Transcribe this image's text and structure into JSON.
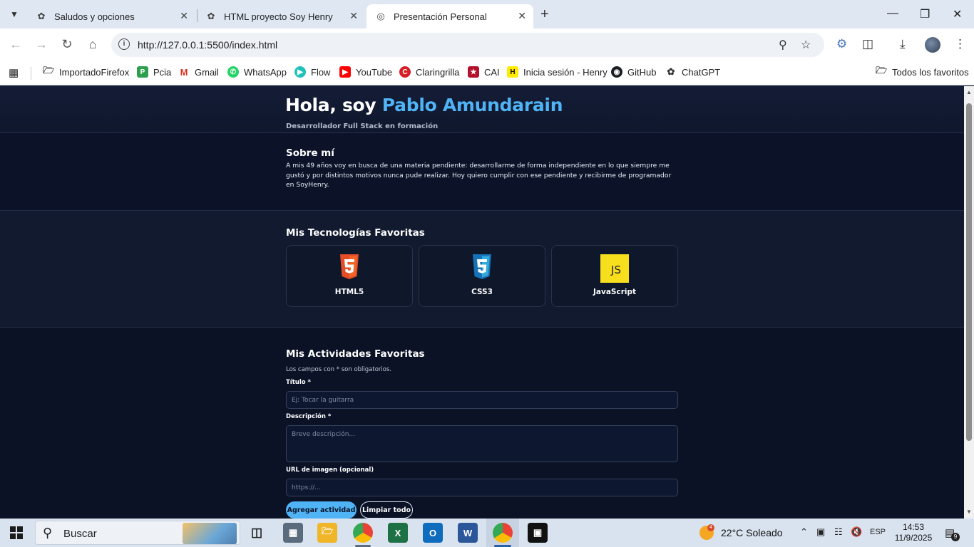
{
  "browser": {
    "tabs": [
      {
        "title": "Saludos y opciones",
        "icon": "chatgpt-icon",
        "active": false
      },
      {
        "title": "HTML proyecto Soy Henry",
        "icon": "chatgpt-icon",
        "active": false
      },
      {
        "title": "Presentación Personal",
        "icon": "globe-icon",
        "active": true
      }
    ],
    "url": "http://127.0.0.1:5500/index.html",
    "bookmarks": [
      {
        "label": "ImportadoFirefox",
        "icon": "folder-icon"
      },
      {
        "label": "Pcia",
        "icon": "pcia-icon"
      },
      {
        "label": "Gmail",
        "icon": "gmail-icon"
      },
      {
        "label": "WhatsApp",
        "icon": "whatsapp-icon"
      },
      {
        "label": "Flow",
        "icon": "flow-icon"
      },
      {
        "label": "YouTube",
        "icon": "youtube-icon"
      },
      {
        "label": "Claringrilla",
        "icon": "claringrilla-icon"
      },
      {
        "label": "CAI",
        "icon": "cai-icon"
      },
      {
        "label": "Inicia sesión - Henry",
        "icon": "henry-icon"
      },
      {
        "label": "GitHub",
        "icon": "github-icon"
      },
      {
        "label": "ChatGPT",
        "icon": "chatgpt-icon"
      }
    ],
    "all_bookmarks": "Todos los favoritos"
  },
  "page": {
    "hero": {
      "greeting": "Hola, soy",
      "name": "Pablo Amundarain",
      "subtitle": "Desarrollador Full Stack en formación"
    },
    "about": {
      "heading": "Sobre mí",
      "text": "A mis 49 años voy en busca de una materia pendiente: desarrollarme de forma independiente en lo que siempre me gustó y por distintos motivos nunca pude realizar. Hoy quiero cumplir con ese pendiente y recibirme de programador en SoyHenry."
    },
    "tech": {
      "heading": "Mis Tecnologías Favoritas",
      "items": [
        {
          "label": "HTML5",
          "icon": "html5-icon",
          "color": "#e44d26",
          "glyph": ""
        },
        {
          "label": "CSS3",
          "icon": "css3-icon",
          "color": "#2a6fd6",
          "glyph": ""
        },
        {
          "label": "JavaScript",
          "icon": "javascript-icon",
          "color": "#f7df1e",
          "glyph": "JS"
        }
      ]
    },
    "activities": {
      "heading": "Mis Actividades Favoritas",
      "note": "Los campos con * son obligatorios.",
      "title_label": "Título *",
      "title_placeholder": "Ej: Tocar la guitarra",
      "desc_label": "Descripción *",
      "desc_placeholder": "Breve descripción...",
      "url_label": "URL de imagen (opcional)",
      "url_placeholder": "https://...",
      "add_button": "Agregar actividad",
      "clear_button": "Limpiar todo"
    },
    "colors": {
      "accent": "#4fb3f5",
      "background": "#0b1226"
    }
  },
  "taskbar": {
    "search": "Buscar",
    "weather_badge": "4",
    "weather": "22°C  Soleado",
    "language": "ESP",
    "time": "14:53",
    "date": "11/9/2025",
    "notifications": "9"
  }
}
